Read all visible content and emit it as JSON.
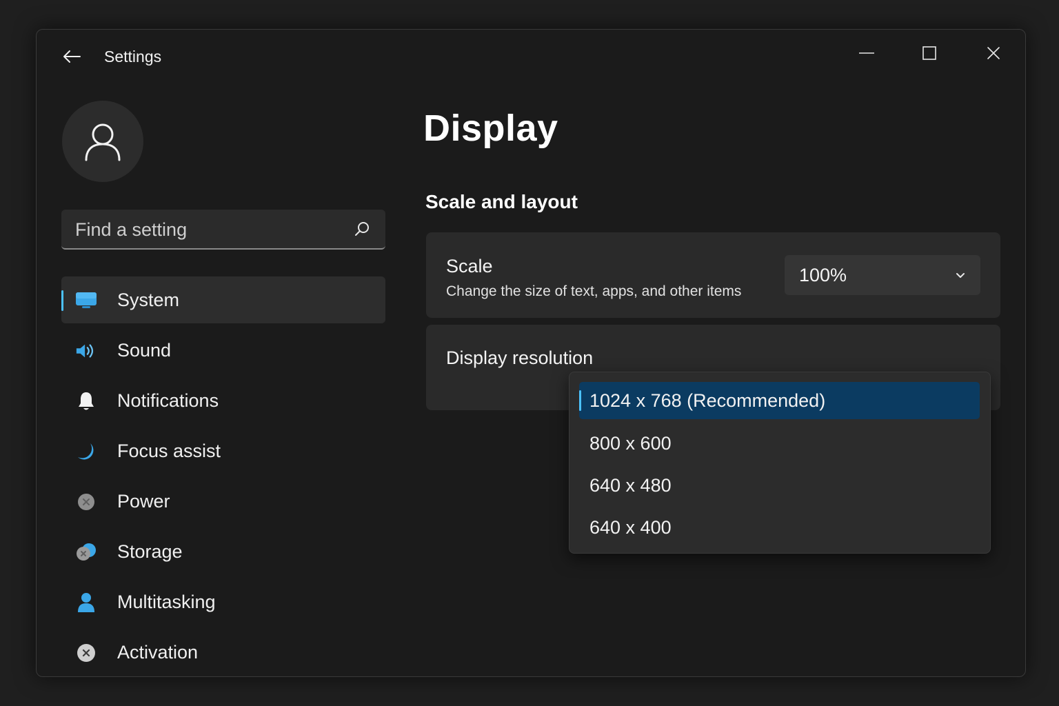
{
  "window": {
    "title": "Settings"
  },
  "sidebar": {
    "search": {
      "placeholder": "Find a setting"
    },
    "items": [
      {
        "label": "System",
        "icon": "monitor-icon",
        "active": true
      },
      {
        "label": "Sound",
        "icon": "speaker-icon",
        "active": false
      },
      {
        "label": "Notifications",
        "icon": "bell-icon",
        "active": false
      },
      {
        "label": "Focus assist",
        "icon": "moon-icon",
        "active": false
      },
      {
        "label": "Power",
        "icon": "power-icon",
        "active": false
      },
      {
        "label": "Storage",
        "icon": "storage-icon",
        "active": false
      },
      {
        "label": "Multitasking",
        "icon": "person-icon",
        "active": false
      },
      {
        "label": "Activation",
        "icon": "activation-icon",
        "active": false
      }
    ]
  },
  "main": {
    "title": "Display",
    "section": "Scale and layout",
    "scale": {
      "title": "Scale",
      "description": "Change the size of text, apps, and other items",
      "value": "100%"
    },
    "resolution": {
      "title": "Display resolution",
      "options": [
        {
          "label": "1024 x 768 (Recommended)",
          "selected": true
        },
        {
          "label": "800 x 600",
          "selected": false
        },
        {
          "label": "640 x 480",
          "selected": false
        },
        {
          "label": "640 x 400",
          "selected": false
        }
      ]
    }
  },
  "colors": {
    "accent": "#4cc2ff",
    "selected_option_bg": "#0b3b61",
    "window_bg": "#1b1b1b",
    "card_bg": "#2a2a2a"
  }
}
